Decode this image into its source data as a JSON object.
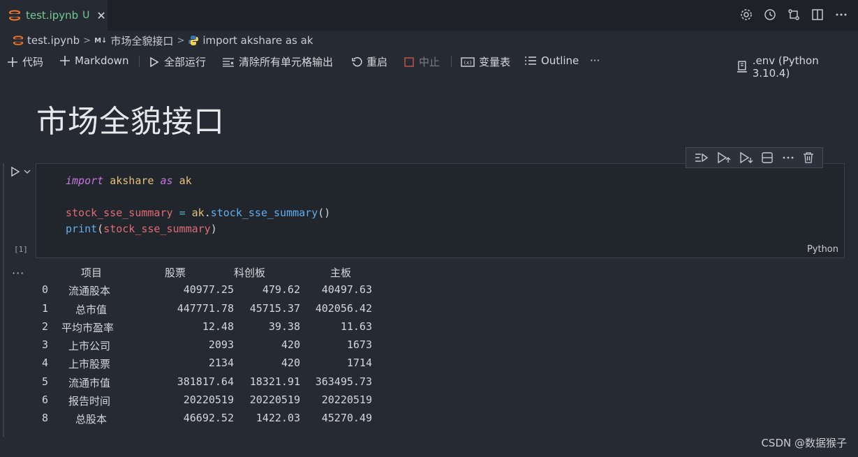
{
  "tab": {
    "name": "test.ipynb",
    "flag": "U",
    "close": "✕"
  },
  "breadcrumb": {
    "file": "test.ipynb",
    "md_badge": "M↓",
    "section": "市场全貌接口",
    "cell": "import akshare as ak"
  },
  "toolbar": {
    "code": "代码",
    "markdown": "Markdown",
    "run_all": "全部运行",
    "clear_outputs": "清除所有单元格输出",
    "restart": "重启",
    "interrupt": "中止",
    "variables": "变量表",
    "outline": "Outline",
    "more": "···",
    "kernel": ".env (Python 3.10.4)"
  },
  "heading": "市场全貌接口",
  "cell": {
    "exec_count": "[1]",
    "language": "Python",
    "code": {
      "l1_kw": "import",
      "l1_mod": "akshare",
      "l1_as": "as",
      "l1_alias": "ak",
      "l3_var": "stock_sse_summary",
      "l3_eq": "=",
      "l3_mod": "ak",
      "l3_dot": ".",
      "l3_fn": "stock_sse_summary",
      "l3_paren": "()",
      "l4_fn": "print",
      "l4_open": "(",
      "l4_var": "stock_sse_summary",
      "l4_close": ")"
    }
  },
  "output": {
    "dots": "···",
    "headers": [
      "项目",
      "股票",
      "科创板",
      "主板"
    ],
    "rows": [
      [
        "0",
        "流通股本",
        "40977.25",
        "479.62",
        "40497.63"
      ],
      [
        "1",
        "总市值",
        "447771.78",
        "45715.37",
        "402056.42"
      ],
      [
        "2",
        "平均市盈率",
        "12.48",
        "39.38",
        "11.63"
      ],
      [
        "3",
        "上市公司",
        "2093",
        "420",
        "1673"
      ],
      [
        "4",
        "上市股票",
        "2134",
        "420",
        "1714"
      ],
      [
        "5",
        "流通市值",
        "381817.64",
        "18321.91",
        "363495.73"
      ],
      [
        "6",
        "报告时间",
        "20220519",
        "20220519",
        "20220519"
      ],
      [
        "8",
        "总股本",
        "46692.52",
        "1422.03",
        "45270.49"
      ]
    ]
  },
  "watermark": "CSDN @数据猴子"
}
